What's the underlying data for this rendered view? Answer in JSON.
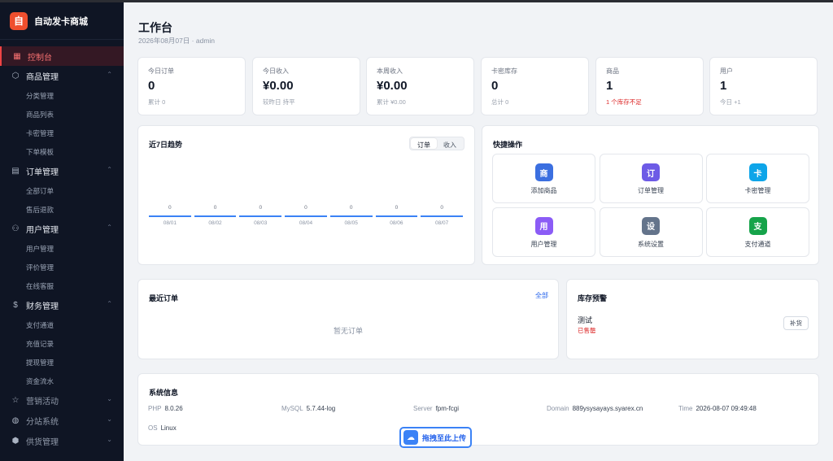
{
  "brand": {
    "logo": "自",
    "name": "自动发卡商城"
  },
  "nav": {
    "dashboard": {
      "icon": "grid-icon",
      "label": "控制台"
    },
    "groups": [
      {
        "icon": "box-icon",
        "label": "商品管理",
        "expanded": true,
        "items": [
          "分类管理",
          "商品列表",
          "卡密管理",
          "下单模板"
        ]
      },
      {
        "icon": "file-icon",
        "label": "订单管理",
        "expanded": true,
        "items": [
          "全部订单",
          "售后退款"
        ]
      },
      {
        "icon": "users-icon",
        "label": "用户管理",
        "expanded": true,
        "items": [
          "用户管理",
          "评价管理",
          "在线客服"
        ]
      },
      {
        "icon": "dollar-icon",
        "label": "财务管理",
        "expanded": true,
        "items": [
          "支付通道",
          "充值记录",
          "提现管理",
          "资金流水"
        ]
      },
      {
        "icon": "star-icon",
        "label": "营销活动",
        "expanded": false,
        "items": []
      },
      {
        "icon": "globe-icon",
        "label": "分站系统",
        "expanded": false,
        "items": []
      },
      {
        "icon": "cube-icon",
        "label": "供货管理",
        "expanded": false,
        "items": []
      }
    ]
  },
  "header": {
    "title": "工作台",
    "subtitle": "2026年08月07日 · admin"
  },
  "stats": [
    {
      "label": "今日订单",
      "value": "0",
      "note": "累计 0",
      "note_color": "gray"
    },
    {
      "label": "今日收入",
      "value": "¥0.00",
      "note": "较昨日 持平",
      "note_color": "gray"
    },
    {
      "label": "本周收入",
      "value": "¥0.00",
      "note": "累计 ¥0.00",
      "note_color": "gray"
    },
    {
      "label": "卡密库存",
      "value": "0",
      "note": "总计 0",
      "note_color": "gray"
    },
    {
      "label": "商品",
      "value": "1",
      "note": "1 个库存不足",
      "note_color": "red"
    },
    {
      "label": "用户",
      "value": "1",
      "note": "今日 +1",
      "note_color": "gray"
    }
  ],
  "trend": {
    "title": "近7日趋势",
    "tabs": [
      "订单",
      "收入"
    ],
    "active_tab": "订单"
  },
  "chart_data": {
    "type": "bar",
    "categories": [
      "08/01",
      "08/02",
      "08/03",
      "08/04",
      "08/05",
      "08/06",
      "08/07"
    ],
    "values": [
      0,
      0,
      0,
      0,
      0,
      0,
      0
    ],
    "title": "近7日趋势",
    "xlabel": "",
    "ylabel": "",
    "grid": false
  },
  "quick_actions": {
    "title": "快捷操作",
    "items": [
      {
        "icon_char": "商",
        "label": "添加商品",
        "color": "#3b6fe0"
      },
      {
        "icon_char": "订",
        "label": "订单管理",
        "color": "#6d5be6"
      },
      {
        "icon_char": "卡",
        "label": "卡密管理",
        "color": "#0ea5e9"
      },
      {
        "icon_char": "用",
        "label": "用户管理",
        "color": "#8b5cf6"
      },
      {
        "icon_char": "设",
        "label": "系统设置",
        "color": "#64748b"
      },
      {
        "icon_char": "支",
        "label": "支付通道",
        "color": "#16a34a"
      }
    ]
  },
  "recent_orders": {
    "title": "最近订单",
    "link": "全部",
    "empty": "暂无订单"
  },
  "inventory": {
    "title": "库存预警",
    "items": [
      {
        "name": "测试",
        "status": "已售罄",
        "action": "补货"
      }
    ]
  },
  "system": {
    "title": "系统信息",
    "items": [
      {
        "key": "PHP",
        "value": "8.0.26"
      },
      {
        "key": "MySQL",
        "value": "5.7.44-log"
      },
      {
        "key": "Server",
        "value": "fpm-fcgi"
      },
      {
        "key": "Domain",
        "value": "889ysysayays.syarex.cn"
      },
      {
        "key": "Time",
        "value": "2026-08-07 09:49:48"
      },
      {
        "key": "OS",
        "value": "Linux"
      }
    ]
  },
  "upload": {
    "icon": "cloud-icon",
    "label": "拖拽至此上传"
  }
}
